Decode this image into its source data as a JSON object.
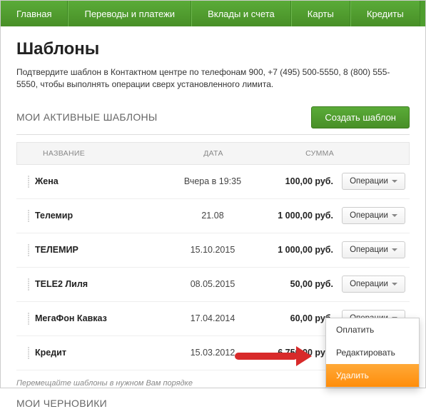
{
  "nav": [
    "Главная",
    "Переводы и платежи",
    "Вклады и счета",
    "Карты",
    "Кредиты"
  ],
  "page": {
    "title": "Шаблоны",
    "subtext": "Подтвердите шаблон в Контактном центре по телефонам 900, +7 (495) 500-5550, 8 (800) 555-5550, чтобы выполнять операции сверх установленного лимита."
  },
  "section": {
    "active_title": "МОИ АКТИВНЫЕ ШАБЛОНЫ",
    "create_label": "Создать шаблон",
    "cols": {
      "name": "НАЗВАНИЕ",
      "date": "ДАТА",
      "sum": "СУММА"
    },
    "ops_label": "Операции",
    "rows": [
      {
        "name": "Жена",
        "date": "Вчера в 19:35",
        "sum": "100,00 руб."
      },
      {
        "name": "Телемир",
        "date": "21.08",
        "sum": "1 000,00 руб."
      },
      {
        "name": "ТЕЛЕМИР",
        "date": "15.10.2015",
        "sum": "1 000,00 руб."
      },
      {
        "name": "TELE2 Лиля",
        "date": "08.05.2015",
        "sum": "50,00 руб."
      },
      {
        "name": "МегаФон Кавказ",
        "date": "17.04.2014",
        "sum": "60,00 руб."
      },
      {
        "name": "Кредит",
        "date": "15.03.2012",
        "sum": "6 750,00 руб."
      }
    ],
    "hint": "Перемещайте шаблоны в нужном Вам порядке",
    "drafts_title": "МОИ ЧЕРНОВИКИ"
  },
  "dropdown": {
    "pay": "Оплатить",
    "edit": "Редактировать",
    "delete": "Удалить"
  }
}
